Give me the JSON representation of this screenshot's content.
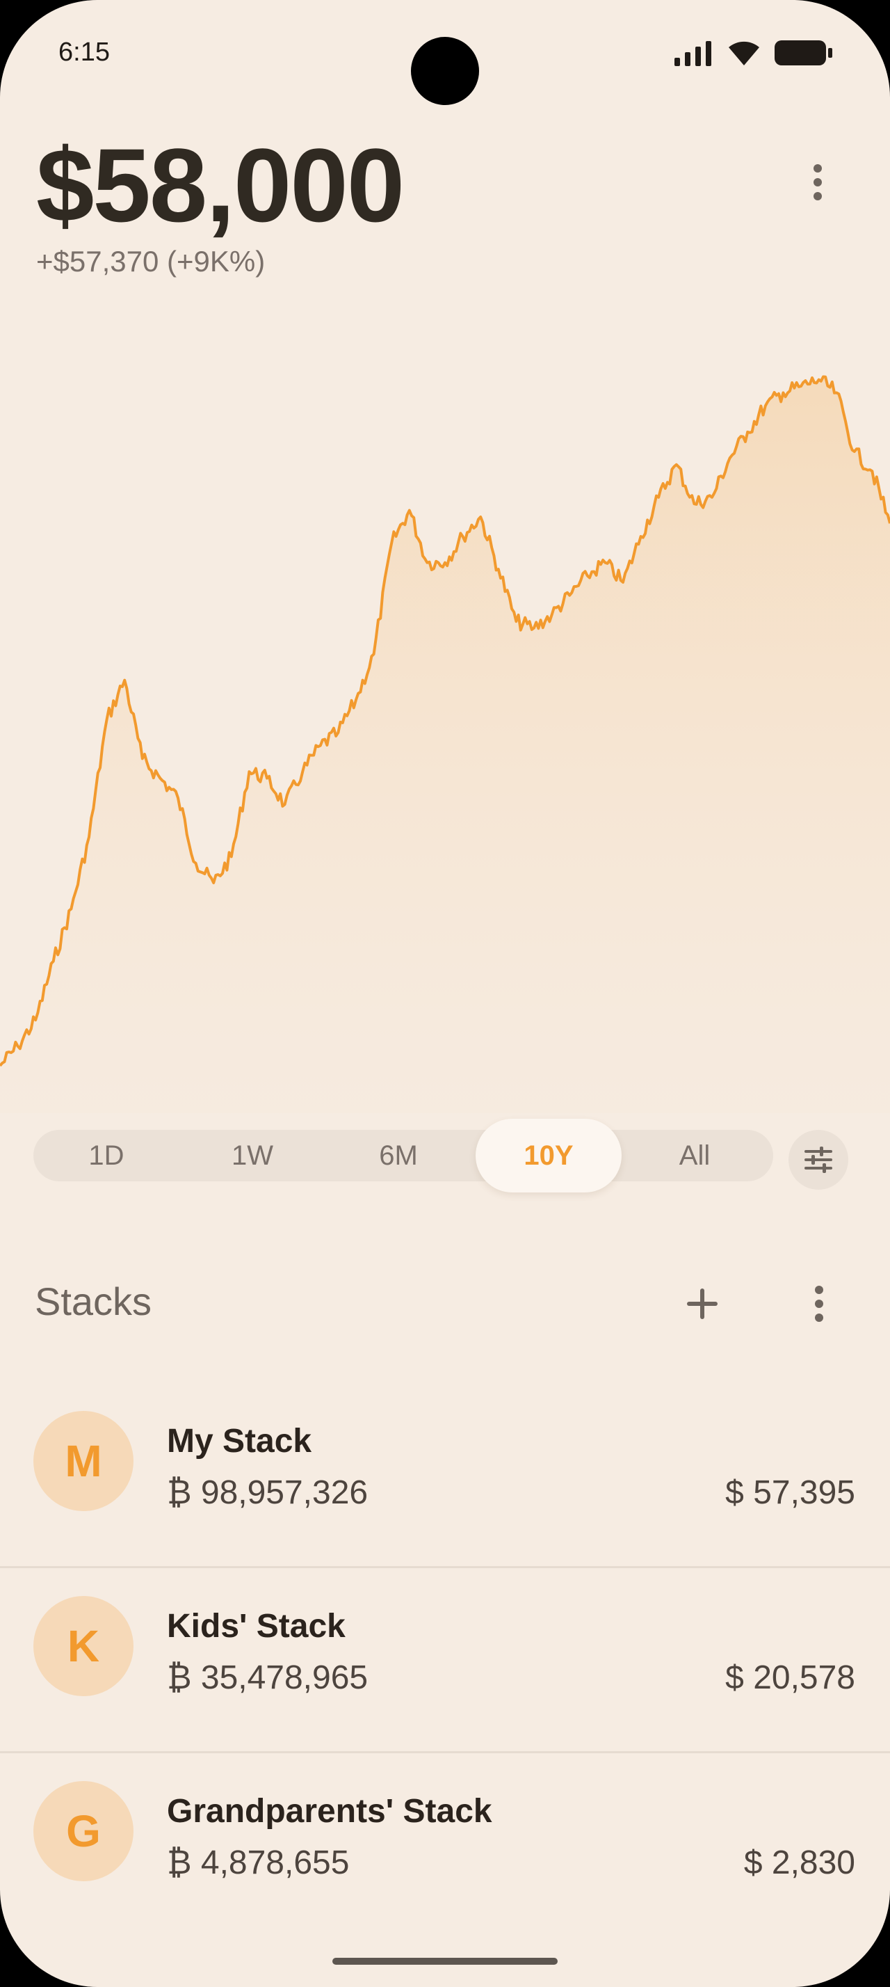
{
  "status_bar": {
    "time": "6:15",
    "icons": [
      "signal-icon",
      "wifi-icon",
      "battery-icon"
    ]
  },
  "header": {
    "balance": "$58,000",
    "change": "+$57,370 (+9K%)"
  },
  "colors": {
    "accent": "#f29a2e",
    "background": "#f6ece2",
    "avatar_bg": "#f6d9b8"
  },
  "chart_data": {
    "type": "area",
    "x": [
      0,
      2,
      4,
      6,
      8,
      10,
      12,
      14,
      16,
      18,
      20,
      22,
      24,
      26,
      28,
      30,
      32,
      34,
      36,
      38,
      40,
      42,
      44,
      46,
      48,
      50,
      52,
      54,
      56,
      58,
      60,
      62,
      64,
      66,
      68,
      70,
      72,
      74,
      76,
      78,
      80,
      82,
      84,
      86,
      88,
      90,
      92,
      94,
      96,
      98,
      100
    ],
    "values": [
      3.0,
      6.0,
      10.0,
      19.0,
      27.0,
      38.0,
      56.0,
      62.0,
      50.0,
      47.0,
      44.0,
      34.0,
      31.0,
      35.0,
      48.0,
      47.0,
      43.0,
      48.0,
      52.0,
      54.0,
      59.0,
      66.0,
      83.0,
      88.0,
      80.0,
      80.0,
      84.0,
      87.0,
      79.0,
      71.0,
      70.0,
      72.0,
      75.0,
      78.0,
      80.0,
      77.0,
      84.0,
      90.0,
      95.0,
      89.0,
      90.0,
      96.0,
      100.0,
      104.0,
      106.0,
      107.0,
      108.0,
      106.0,
      97.0,
      94.0,
      86.0
    ]
  },
  "range": {
    "options": [
      "1D",
      "1W",
      "6M",
      "10Y",
      "All"
    ],
    "selected": "10Y"
  },
  "stacks": {
    "title": "Stacks",
    "items": [
      {
        "initial": "M",
        "name": "My Stack",
        "btc": "₿ 98,957,326",
        "usd": "$ 57,395"
      },
      {
        "initial": "K",
        "name": "Kids' Stack",
        "btc": "₿ 35,478,965",
        "usd": "$ 20,578"
      },
      {
        "initial": "G",
        "name": "Grandparents' Stack",
        "btc": "₿ 4,878,655",
        "usd": "$ 2,830"
      }
    ]
  }
}
